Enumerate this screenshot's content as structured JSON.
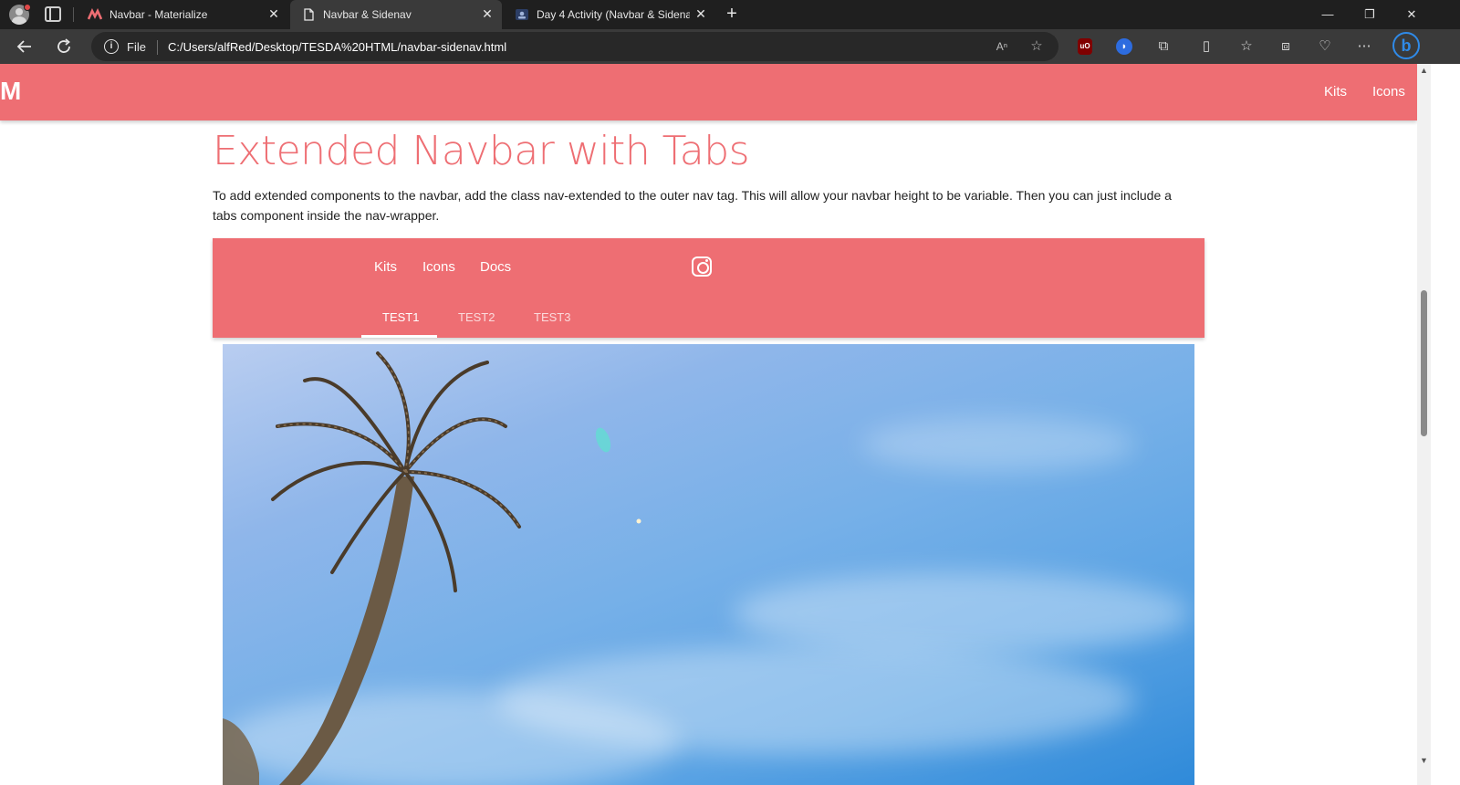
{
  "browser": {
    "tabs": [
      {
        "title": "Navbar - Materialize",
        "active": false
      },
      {
        "title": "Navbar & Sidenav",
        "active": true
      },
      {
        "title": "Day 4 Activity (Navbar & Sidenav",
        "active": false
      }
    ],
    "new_tab_symbol": "+",
    "window_controls": {
      "minimize": "—",
      "restore": "❐",
      "close": "✕"
    },
    "address": {
      "scheme_label": "File",
      "url": "C:/Users/alfRed/Desktop/TESDA%20HTML/navbar-sidenav.html"
    },
    "icons": [
      "back-icon",
      "refresh-icon",
      "read-aloud-icon",
      "favorite-star-icon",
      "ublock-icon",
      "extension-blue-icon",
      "extensions-icon",
      "split-screen-icon",
      "favorites-icon",
      "collections-icon",
      "health-icon",
      "more-icon",
      "bing-icon"
    ]
  },
  "page": {
    "brand": "M",
    "top_nav": [
      "Kits",
      "Icons"
    ],
    "heading": "Extended Navbar with Tabs",
    "description": "To add extended components to the navbar, add the class nav-extended to the outer nav tag. This will allow your navbar height to be variable. Then you can just include a tabs component inside the nav-wrapper.",
    "extended_nav": {
      "links": [
        "Kits",
        "Icons",
        "Docs"
      ],
      "tabs": [
        "TEST1",
        "TEST2",
        "TEST3"
      ],
      "active_tab": "TEST1"
    }
  },
  "colors": {
    "accent": "#ee6e73",
    "chrome_dark": "#1f1f1f",
    "chrome_toolbar": "#3a3a3a"
  }
}
